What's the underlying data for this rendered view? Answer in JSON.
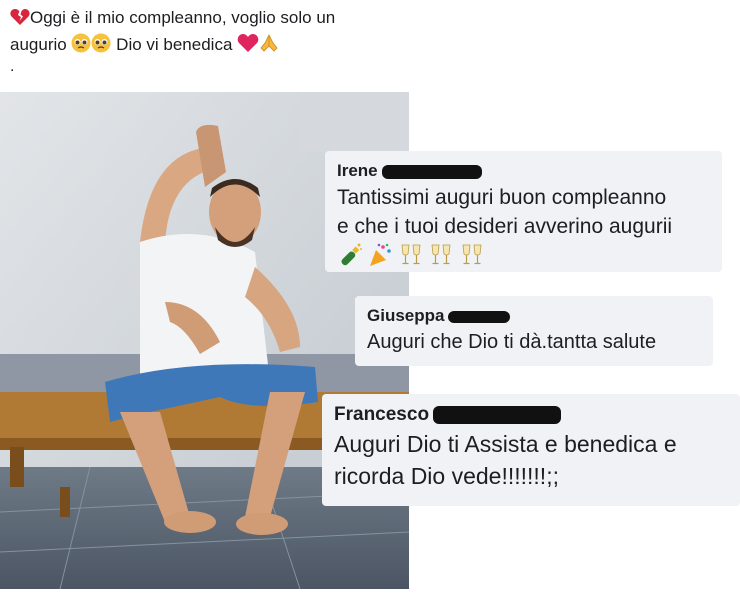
{
  "post": {
    "line1": "Oggi è il mio compleanno, voglio solo un",
    "line2_part1": "augurio ",
    "line2_part2": " Dio vi benedica ",
    "line3": ".",
    "icons": [
      "broken-heart-icon",
      "pleading-face-icon",
      "pleading-face-icon",
      "red-heart-icon",
      "folded-hands-icon"
    ]
  },
  "comments": [
    {
      "name": "Irene",
      "text_lines": [
        "Tantissimi auguri buon compleanno",
        "e che i tuoi desideri avverino  augurii"
      ],
      "emojis": [
        "champagne-icon",
        "party-popper-icon",
        "clinking-glasses-icon",
        "clinking-glasses-icon",
        "clinking-glasses-icon"
      ]
    },
    {
      "name": "Giuseppa",
      "text_lines": [
        "Auguri che  Dio ti dà.tantta salute"
      ]
    },
    {
      "name": "Francesco",
      "text_lines": [
        "Auguri Dio ti Assista e benedica e",
        "ricorda Dio vede!!!!!!!;;"
      ]
    }
  ],
  "colors": {
    "comment_bg": "#f0f2f5",
    "text": "#1c1e21",
    "heart": "#e0245e",
    "jeans": "#3f78b8"
  }
}
